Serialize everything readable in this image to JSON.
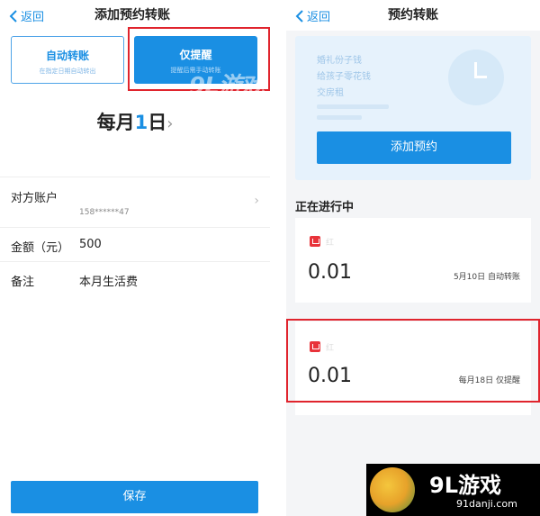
{
  "left": {
    "nav": {
      "back_label": "返回",
      "title": "添加预约转账"
    },
    "modes": [
      {
        "title": "自动转账",
        "subtitle": "在指定日期自动转出"
      },
      {
        "title": "仅提醒",
        "subtitle": "提醒后需手动转账"
      }
    ],
    "watermark": "9L游戏",
    "schedule": {
      "prefix": "每月",
      "day": "1",
      "suffix": "日",
      "chevron": "›"
    },
    "form": {
      "account_label": "对方账户",
      "account_value": "158******47",
      "amount_label": "金额（元）",
      "amount_value": "500",
      "note_label": "备注",
      "note_value": "本月生活费"
    },
    "save_label": "保存"
  },
  "right": {
    "nav": {
      "back_label": "返回",
      "title": "预约转账"
    },
    "hero": {
      "lines": [
        "婚礼份子钱",
        "给孩子零花钱",
        "交房租"
      ],
      "button_label": "添加预约"
    },
    "section_title": "正在进行中",
    "tasks": [
      {
        "name": "红",
        "amount": "0.01",
        "meta": "5月10日 自动转账"
      },
      {
        "name": "红",
        "amount": "0.01",
        "meta": "每月18日 仅提醒"
      }
    ]
  },
  "logo": {
    "text": "9L游戏",
    "url": "91danji.com"
  },
  "colors": {
    "accent": "#1a8fe3",
    "highlight": "#e0242d",
    "task_icon": "#e8333a"
  }
}
